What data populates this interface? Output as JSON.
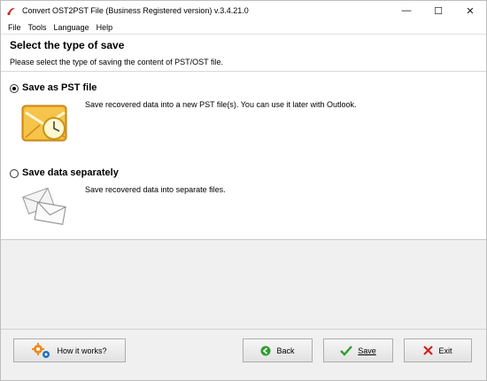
{
  "window": {
    "title": "Convert OST2PST File (Business Registered version) v.3.4.21.0",
    "minimize": "—",
    "maximize": "☐",
    "close": "✕"
  },
  "menu": [
    "File",
    "Tools",
    "Language",
    "Help"
  ],
  "header": {
    "title": "Select the type of save",
    "subtitle": "Please select the type of saving the content of PST/OST file."
  },
  "options": [
    {
      "label": "Save as PST file",
      "description": "Save recovered data into a new PST file(s). You can use it later with Outlook.",
      "selected": true,
      "icon": "outlook-envelope-icon"
    },
    {
      "label": "Save data separately",
      "description": "Save recovered data into separate files.",
      "selected": false,
      "icon": "separate-envelopes-icon"
    }
  ],
  "buttons": {
    "how_it_works": "How it works?",
    "back": "Back",
    "save": "Save",
    "exit": "Exit"
  },
  "colors": {
    "accent_green": "#2f9e2f",
    "exit_red": "#d32020",
    "gear_orange": "#f08a1c",
    "gear_blue": "#1e6fc4"
  }
}
